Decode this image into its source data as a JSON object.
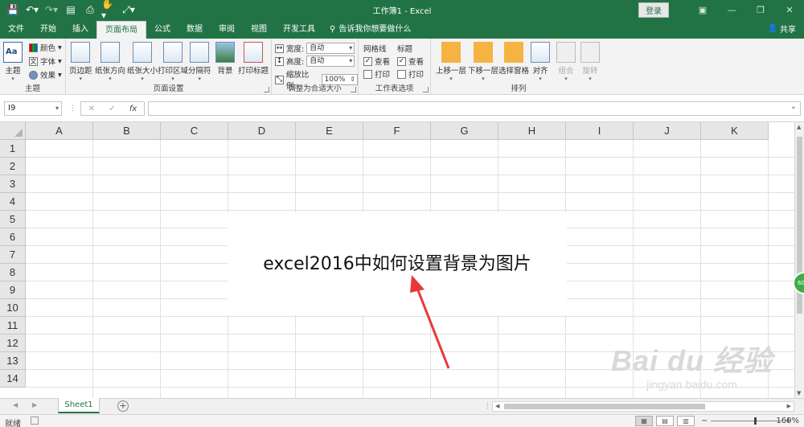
{
  "titlebar": {
    "title": "工作簿1 - Excel",
    "login": "登录",
    "icons": [
      "save-icon",
      "undo-icon",
      "redo-icon",
      "form-icon",
      "print-preview-icon",
      "touch-mode-icon",
      "customize-icon"
    ]
  },
  "tabs": [
    {
      "label": "文件"
    },
    {
      "label": "开始"
    },
    {
      "label": "插入"
    },
    {
      "label": "页面布局",
      "active": true
    },
    {
      "label": "公式"
    },
    {
      "label": "数据"
    },
    {
      "label": "审阅"
    },
    {
      "label": "视图"
    },
    {
      "label": "开发工具"
    }
  ],
  "search": {
    "placeholder": "告诉我你想要做什么"
  },
  "share": {
    "label": "共享"
  },
  "ribbon": {
    "theme_group": {
      "name": "主题",
      "theme_btn": "主题",
      "colors": "颜色",
      "fonts": "字体",
      "effects": "效果"
    },
    "page_setup_group": {
      "name": "页面设置",
      "buttons": [
        "页边距",
        "纸张方向",
        "纸张大小",
        "打印区域",
        "分隔符",
        "背景",
        "打印标题"
      ]
    },
    "scale_group": {
      "name": "调整为合适大小",
      "width_label": "宽度:",
      "width_value": "自动",
      "height_label": "高度:",
      "height_value": "自动",
      "scale_label": "缩放比例:",
      "scale_value": "100%"
    },
    "sheet_options_group": {
      "name": "工作表选项",
      "gridlines": "网格线",
      "headings": "标题",
      "view": "查看",
      "print": "打印"
    },
    "arrange_group": {
      "name": "排列",
      "buttons": [
        "上移一层",
        "下移一层",
        "选择窗格",
        "对齐",
        "组合",
        "旋转"
      ]
    }
  },
  "formula_bar": {
    "name_box": "I9",
    "fx": "fx",
    "cancel": "✕",
    "enter": "✓",
    "value": ""
  },
  "grid": {
    "columns": [
      "A",
      "B",
      "C",
      "D",
      "E",
      "F",
      "G",
      "H",
      "I",
      "J",
      "K"
    ],
    "rows": [
      "1",
      "2",
      "3",
      "4",
      "5",
      "6",
      "7",
      "8",
      "9",
      "10",
      "11",
      "12",
      "13",
      "14"
    ],
    "caption": "excel2016中如何设置背景为图片"
  },
  "watermark": {
    "line1": "Bai du 经验",
    "line2": "jingyan.baidu.com"
  },
  "side_badge": "60",
  "sheets": [
    {
      "label": "Sheet1",
      "active": true
    }
  ],
  "status": {
    "ready": "就绪",
    "zoom": "160%"
  },
  "colors": {
    "accent": "#217346",
    "ribbon_bg": "#f3f3f3",
    "arrow": "#e8383a"
  }
}
